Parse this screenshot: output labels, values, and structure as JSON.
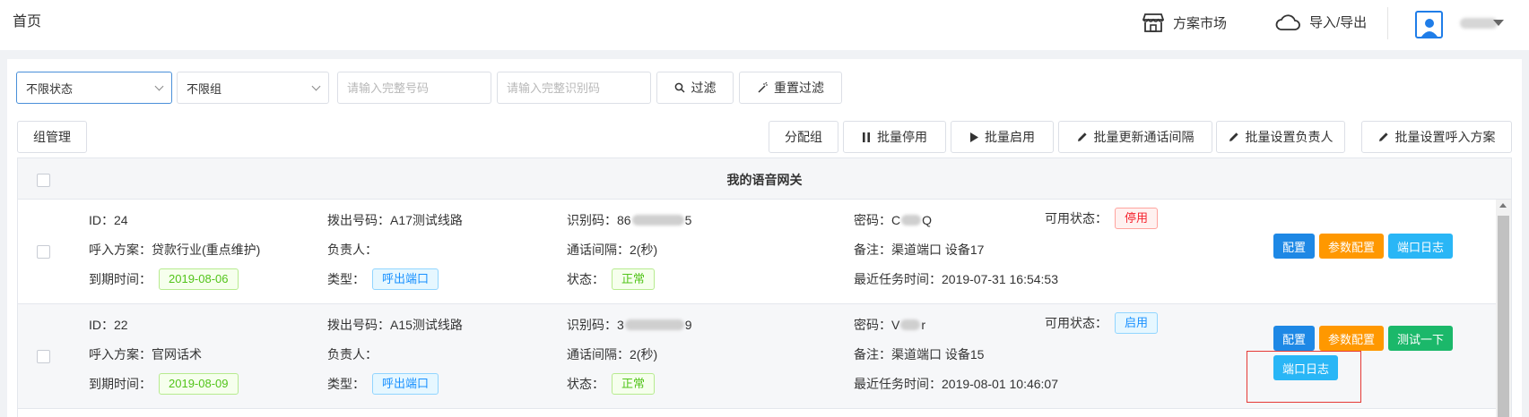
{
  "header": {
    "page_title": "首页",
    "market_label": "方案市场",
    "import_export_label": "导入/导出"
  },
  "filters": {
    "status_select": "不限状态",
    "group_select": "不限组",
    "number_placeholder": "请输入完整号码",
    "id_code_placeholder": "请输入完整识别码",
    "filter_btn": "过滤",
    "reset_btn": "重置过滤"
  },
  "toolbar": {
    "group_manage": "组管理",
    "assign_group": "分配组",
    "batch_disable": "批量停用",
    "batch_enable": "批量启用",
    "batch_update_interval": "批量更新通话间隔",
    "batch_set_owner": "批量设置负责人",
    "batch_set_inbound": "批量设置呼入方案"
  },
  "table": {
    "title": "我的语音网关",
    "rows": [
      {
        "id_label": "ID：",
        "id": "24",
        "dial_label": "拨出号码：",
        "dial": "A17测试线路",
        "code_label": "识别码：",
        "code_prefix": "86",
        "code_suffix": "5",
        "password_label": "密码：",
        "password_prefix": "C",
        "password_suffix": "Q",
        "avail_label": "可用状态：",
        "avail": "停用",
        "inbound_label": "呼入方案：",
        "inbound": "贷款行业(重点维护)",
        "owner_label": "负责人：",
        "owner": "",
        "interval_label": "通话间隔：",
        "interval": "2(秒)",
        "remark_label": "备注：",
        "remark": "渠道端口 设备17",
        "expire_label": "到期时间：",
        "expire": "2019-08-06",
        "type_label": "类型：",
        "type": "呼出端口",
        "state_label": "状态：",
        "state": "正常",
        "last_task_label": "最近任务时间：",
        "last_task": "2019-07-31 16:54:53",
        "actions": [
          "配置",
          "参数配置",
          "端口日志"
        ]
      },
      {
        "id_label": "ID：",
        "id": "22",
        "dial_label": "拨出号码：",
        "dial": "A15测试线路",
        "code_label": "识别码：",
        "code_prefix": "3",
        "code_suffix": "9",
        "password_label": "密码：",
        "password_prefix": "V",
        "password_suffix": "r",
        "avail_label": "可用状态：",
        "avail": "启用",
        "inbound_label": "呼入方案：",
        "inbound": "官网话术",
        "owner_label": "负责人：",
        "owner": "",
        "interval_label": "通话间隔：",
        "interval": "2(秒)",
        "remark_label": "备注：",
        "remark": "渠道端口 设备15",
        "expire_label": "到期时间：",
        "expire": "2019-08-09",
        "type_label": "类型：",
        "type": "呼出端口",
        "state_label": "状态：",
        "state": "正常",
        "last_task_label": "最近任务时间：",
        "last_task": "2019-08-01 10:46:07",
        "actions": [
          "配置",
          "参数配置",
          "测试一下",
          "端口日志"
        ]
      }
    ]
  },
  "colors": {
    "primary": "#1e88e5",
    "warning": "#ff9800",
    "info": "#29b6f6",
    "success": "#1bb86a",
    "danger": "#e53935"
  }
}
